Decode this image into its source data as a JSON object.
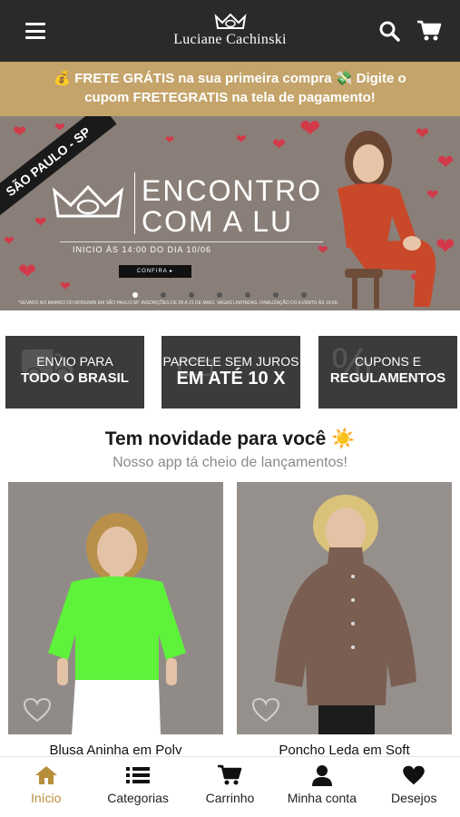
{
  "header": {
    "brand": "Luciane Cachinski"
  },
  "promo": {
    "line1": "💰 FRETE GRÁTIS na sua primeira compra 💸 Digite o",
    "line2": "cupom FRETEGRATIS na tela de pagamento!"
  },
  "banner": {
    "ribbon": "SÃO PAULO - SP",
    "title_line1": "ENCONTRO",
    "title_line2": "COM A LU",
    "subtitle": "INICIO ÀS 14:00 DO DIA 10/06",
    "button": "CONFIRA ▸",
    "fine_print": "*SEVADO NO BAIRRO DO MORUMBI EM SÃO PAULO-SP. INSCRIÇÕES DE 28 À 21 DE MAIO. VAGAS LIMITADAS. FINALIZAÇÃO DO EVENTO ÀS 16:00.",
    "slide_count": 7,
    "active_slide": 1
  },
  "info_boxes": [
    {
      "line1": "ENVIO PARA",
      "line2": "TODO O BRASIL"
    },
    {
      "line1": "PARCELE SEM JUROS",
      "line2": "EM ATÉ 10 X"
    },
    {
      "line1": "CUPONS E",
      "line2": "REGULAMENTOS"
    }
  ],
  "section": {
    "title": "Tem novidade para você ☀️",
    "subtitle": "Nosso app tá cheio de lançamentos!"
  },
  "products": [
    {
      "name": "Blusa Aninha em Poly",
      "shirt_color": "#5ef23a"
    },
    {
      "name": "Poncho Leda em Soft",
      "shirt_color": "#7a5e52"
    }
  ],
  "bottom_nav": [
    {
      "label": "Início",
      "icon": "home-icon",
      "active": true
    },
    {
      "label": "Categorias",
      "icon": "list-icon",
      "active": false
    },
    {
      "label": "Carrinho",
      "icon": "cart-icon",
      "active": false
    },
    {
      "label": "Minha conta",
      "icon": "user-icon",
      "active": false
    },
    {
      "label": "Desejos",
      "icon": "heart-icon",
      "active": false
    }
  ],
  "colors": {
    "header": "#2a2a2a",
    "promo": "#c4a46a",
    "accent": "#b78f3c",
    "box": "#3b3b3b"
  }
}
